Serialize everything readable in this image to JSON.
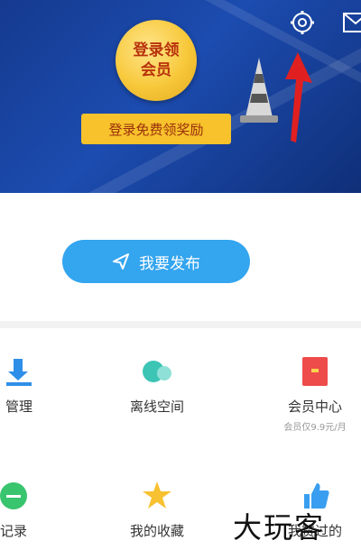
{
  "hero": {
    "badge_text": "登录领会员",
    "badge_line1": "登录领",
    "badge_line2": "会员",
    "claim_button": "登录免费领奖励"
  },
  "publish": {
    "label": "我要发布"
  },
  "grid": {
    "items": [
      {
        "label": "管理",
        "icon": "download-icon"
      },
      {
        "label": "离线空间",
        "icon": "cloud-icon"
      },
      {
        "label": "会员中心",
        "sub": "会员仅9.9元/月",
        "icon": "red-envelope-icon"
      },
      {
        "label": "记录",
        "icon": "record-icon"
      },
      {
        "label": "我的收藏",
        "icon": "star-icon"
      },
      {
        "label": "我赞过的",
        "icon": "thumbs-up-icon"
      }
    ]
  },
  "watermark": "大玩客",
  "colors": {
    "hero": "#1c4cb0",
    "accent_blue": "#34a5ef",
    "gold": "#f7c22b",
    "arrow_red": "#e02020"
  }
}
